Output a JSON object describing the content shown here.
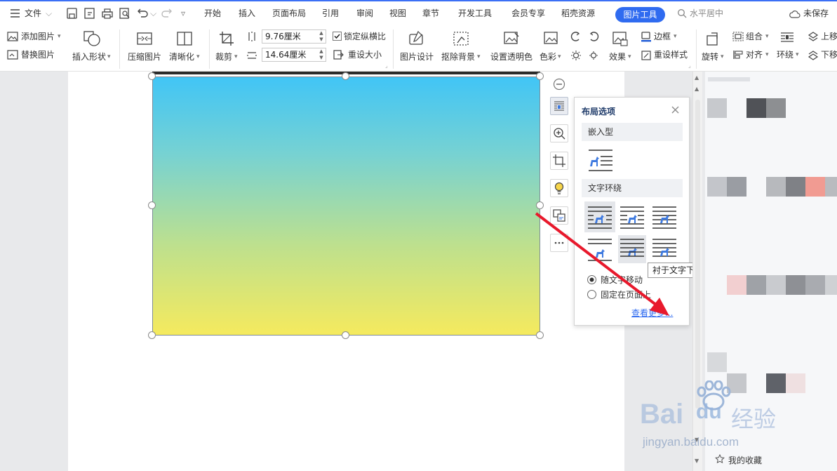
{
  "menubar": {
    "file_label": "文件",
    "tabs": [
      "开始",
      "插入",
      "页面布局",
      "引用",
      "审阅",
      "视图",
      "章节",
      "开发工具",
      "会员专享",
      "稻壳资源"
    ],
    "active_tab": "图片工具",
    "search_placeholder": "水平居中",
    "unsaved": "未保存"
  },
  "ribbon": {
    "add_picture": "添加图片",
    "replace_picture": "替换图片",
    "insert_shape": "插入形状",
    "compress_picture": "压缩图片",
    "sharpen": "清晰化",
    "crop": "裁剪",
    "height_value": "9.76厘米",
    "width_value": "14.64厘米",
    "lock_ratio": "锁定纵横比",
    "reset_size": "重设大小",
    "picture_design": "图片设计",
    "remove_background": "抠除背景",
    "set_transparent": "设置透明色",
    "color": "色彩",
    "effects": "效果",
    "border": "边框",
    "reset_style": "重设样式",
    "rotate": "旋转",
    "group": "组合",
    "align": "对齐",
    "wrap": "环绕",
    "move_up": "上移",
    "move_down": "下移"
  },
  "layout_panel": {
    "title": "布局选项",
    "inline_section": "嵌入型",
    "wrap_section": "文字环绕",
    "radio_move_with_text": "随文字移动",
    "radio_fix_on_page": "固定在页面上",
    "more_link": "查看更多...",
    "tooltip": "衬于文字下"
  },
  "right_panel": {
    "favorites": "我的收藏"
  },
  "watermark": {
    "brand": "Bai",
    "brand2": "du",
    "product": "经验",
    "url": "jingyan.baidu.com"
  },
  "colors": {
    "accent": "#2f6bf0",
    "gradient_top": "#41c5f6",
    "gradient_bottom": "#f5ea5e",
    "arrow": "#e8192c",
    "wrap_icon_blue": "#3e7ae0"
  }
}
